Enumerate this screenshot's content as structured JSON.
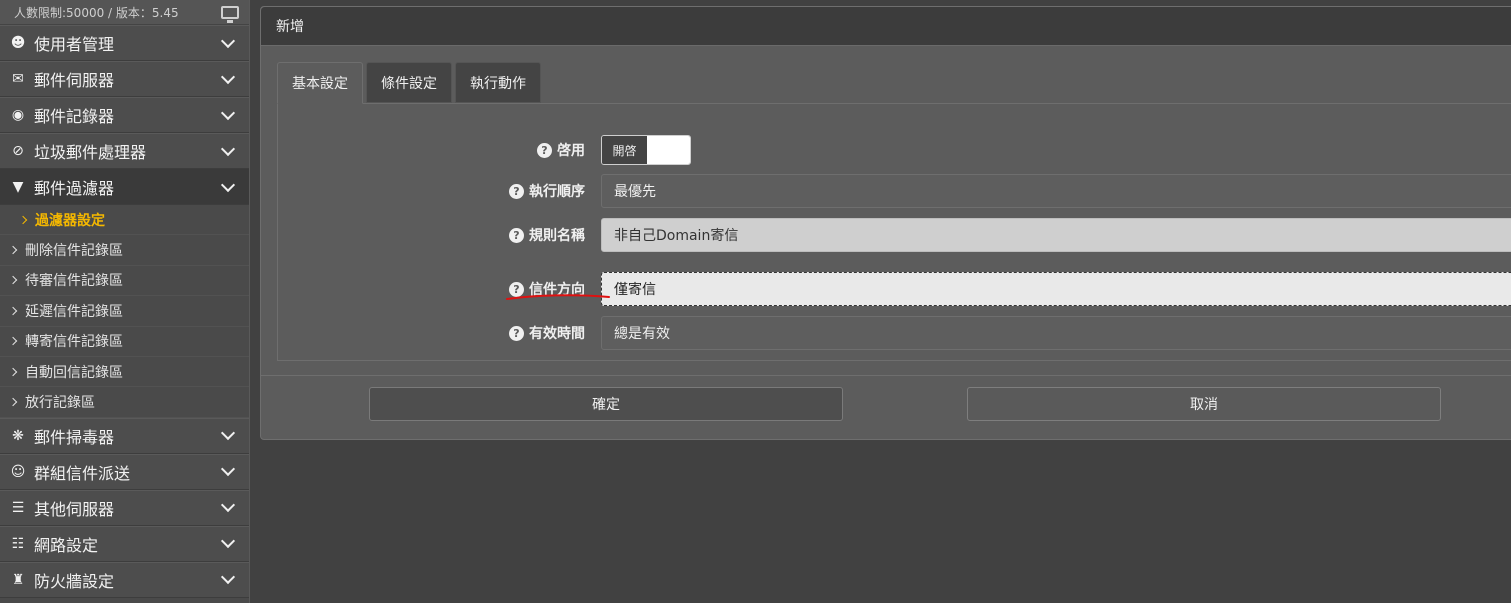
{
  "sidebar": {
    "top_info": "人數限制:50000 / 版本：5.45",
    "monitor_icon": "monitor-icon",
    "items": [
      {
        "label": "使用者管理",
        "icon": "user-icon"
      },
      {
        "label": "郵件伺服器",
        "icon": "envelope-icon"
      },
      {
        "label": "郵件記錄器",
        "icon": "camera-icon"
      },
      {
        "label": "垃圾郵件處理器",
        "icon": "ban-icon"
      },
      {
        "label": "郵件過濾器",
        "icon": "filter-icon"
      }
    ],
    "subitems": [
      {
        "label": "過濾器設定"
      },
      {
        "label": "刪除信件記錄區"
      },
      {
        "label": "待審信件記錄區"
      },
      {
        "label": "延遲信件記錄區"
      },
      {
        "label": "轉寄信件記錄區"
      },
      {
        "label": "自動回信記錄區"
      },
      {
        "label": "放行記錄區"
      }
    ],
    "items_after": [
      {
        "label": "郵件掃毒器",
        "icon": "bug-icon"
      },
      {
        "label": "群組信件派送",
        "icon": "users-icon"
      },
      {
        "label": "其他伺服器",
        "icon": "server-icon"
      },
      {
        "label": "網路設定",
        "icon": "sitemap-icon"
      },
      {
        "label": "防火牆設定",
        "icon": "castle-icon"
      }
    ],
    "accent_color": "#f5b800"
  },
  "modal": {
    "title": "新增",
    "tabs": [
      {
        "label": "基本設定"
      },
      {
        "label": "條件設定"
      },
      {
        "label": "執行動作"
      }
    ],
    "fields": {
      "enable": {
        "label": "啓用",
        "toggle_label": "開啓"
      },
      "order": {
        "label": "執行順序",
        "value": "最優先"
      },
      "rule_name": {
        "label": "規則名稱",
        "value": "非自己Domain寄信"
      },
      "direction": {
        "label": "信件方向",
        "value": "僅寄信"
      },
      "validity": {
        "label": "有效時間",
        "value": "總是有效"
      }
    },
    "buttons": {
      "confirm": "確定",
      "cancel": "取消"
    },
    "annotation_color": "#e01010"
  }
}
